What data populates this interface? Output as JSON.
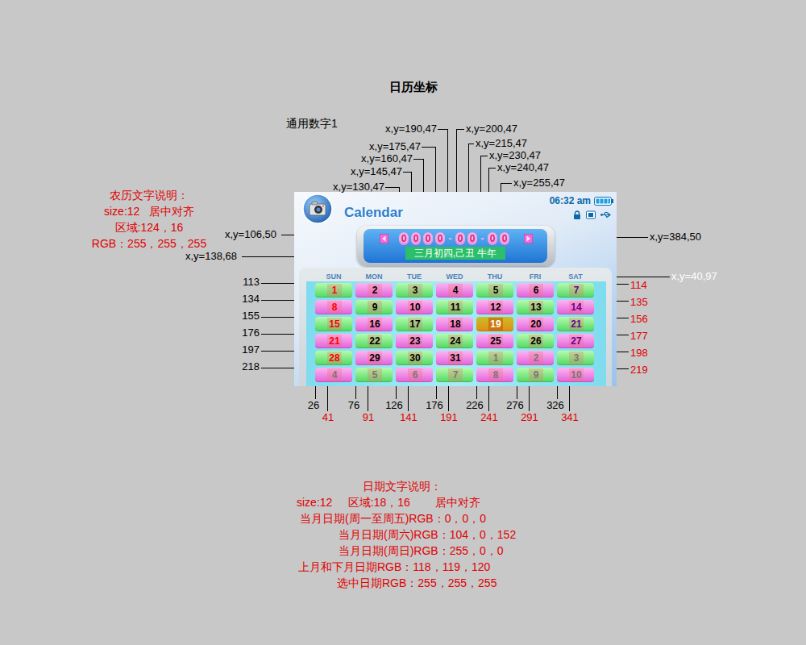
{
  "page": {
    "title": "日历坐标",
    "subtitle": "通用数字1"
  },
  "top_labels": [
    {
      "text": "x,y=190,47"
    },
    {
      "text": "x,y=175,47"
    },
    {
      "text": "x,y=160,47"
    },
    {
      "text": "x,y=145,47"
    },
    {
      "text": "x,y=130,47"
    },
    {
      "text": "x,y=200,47"
    },
    {
      "text": "x,y=215,47"
    },
    {
      "text": "x,y=230,47"
    },
    {
      "text": "x,y=240,47"
    },
    {
      "text": "x,y=255,47"
    }
  ],
  "side_labels": [
    {
      "text": "x,y=106,50"
    },
    {
      "text": "x,y=138,68"
    },
    {
      "text": "x,y=384,50"
    },
    {
      "text": "x,y=40,97"
    }
  ],
  "row_labels": {
    "cell_top": [
      "113",
      "134",
      "155",
      "176",
      "197",
      "218"
    ],
    "box_top": [
      "114",
      "135",
      "156",
      "177",
      "198",
      "219"
    ]
  },
  "column_labels": {
    "cell_left": [
      "26",
      "76",
      "126",
      "176",
      "226",
      "276",
      "326"
    ],
    "box_left": [
      "41",
      "91",
      "141",
      "191",
      "241",
      "291",
      "341"
    ]
  },
  "lunar_note": [
    "农历文字说明：",
    "size:12   居中对齐",
    "区域:124，16",
    "RGB：255，255，255"
  ],
  "date_note": [
    "日期文字说明：",
    "size:12     区域:18，16        居中对齐",
    "当月日期(周一至周五)RGB：0，0，0",
    "当月日期(周六)RGB：104，0，152",
    "当月日期(周日)RGB：255，0，0",
    "上月和下月日期RGB：118，119，120",
    "选中日期RGB：255，255，255"
  ],
  "calendar": {
    "app_title": "Calendar",
    "time": "06:32 am",
    "date": "0000-00-00",
    "lunar": "三月初四,己丑 牛年",
    "weekdays": [
      "SUN",
      "MON",
      "TUE",
      "WED",
      "THU",
      "FRI",
      "SAT"
    ],
    "weeks": [
      [
        {
          "day": "1",
          "kind": "current",
          "selected": false
        },
        {
          "day": "2",
          "kind": "current",
          "selected": false
        },
        {
          "day": "3",
          "kind": "current",
          "selected": false
        },
        {
          "day": "4",
          "kind": "current",
          "selected": false
        },
        {
          "day": "5",
          "kind": "current",
          "selected": false
        },
        {
          "day": "6",
          "kind": "current",
          "selected": false
        },
        {
          "day": "7",
          "kind": "current",
          "selected": false
        }
      ],
      [
        {
          "day": "8",
          "kind": "current",
          "selected": false
        },
        {
          "day": "9",
          "kind": "current",
          "selected": false
        },
        {
          "day": "10",
          "kind": "current",
          "selected": false
        },
        {
          "day": "11",
          "kind": "current",
          "selected": false
        },
        {
          "day": "12",
          "kind": "current",
          "selected": false
        },
        {
          "day": "13",
          "kind": "current",
          "selected": false
        },
        {
          "day": "14",
          "kind": "current",
          "selected": false
        }
      ],
      [
        {
          "day": "15",
          "kind": "current",
          "selected": false
        },
        {
          "day": "16",
          "kind": "current",
          "selected": false
        },
        {
          "day": "17",
          "kind": "current",
          "selected": false
        },
        {
          "day": "18",
          "kind": "current",
          "selected": false
        },
        {
          "day": "19",
          "kind": "current",
          "selected": true
        },
        {
          "day": "20",
          "kind": "current",
          "selected": false
        },
        {
          "day": "21",
          "kind": "current",
          "selected": false
        }
      ],
      [
        {
          "day": "21",
          "kind": "current",
          "selected": false
        },
        {
          "day": "22",
          "kind": "current",
          "selected": false
        },
        {
          "day": "23",
          "kind": "current",
          "selected": false
        },
        {
          "day": "24",
          "kind": "current",
          "selected": false
        },
        {
          "day": "25",
          "kind": "current",
          "selected": false
        },
        {
          "day": "26",
          "kind": "current",
          "selected": false
        },
        {
          "day": "27",
          "kind": "current",
          "selected": false
        }
      ],
      [
        {
          "day": "28",
          "kind": "current",
          "selected": false
        },
        {
          "day": "29",
          "kind": "current",
          "selected": false
        },
        {
          "day": "30",
          "kind": "current",
          "selected": false
        },
        {
          "day": "31",
          "kind": "current",
          "selected": false
        },
        {
          "day": "1",
          "kind": "other",
          "selected": false
        },
        {
          "day": "2",
          "kind": "other",
          "selected": false
        },
        {
          "day": "3",
          "kind": "other",
          "selected": false
        }
      ],
      [
        {
          "day": "4",
          "kind": "other",
          "selected": false
        },
        {
          "day": "5",
          "kind": "other",
          "selected": false
        },
        {
          "day": "6",
          "kind": "other",
          "selected": false
        },
        {
          "day": "7",
          "kind": "other",
          "selected": false
        },
        {
          "day": "8",
          "kind": "other",
          "selected": false
        },
        {
          "day": "9",
          "kind": "other",
          "selected": false
        },
        {
          "day": "10",
          "kind": "other",
          "selected": false
        }
      ]
    ]
  }
}
